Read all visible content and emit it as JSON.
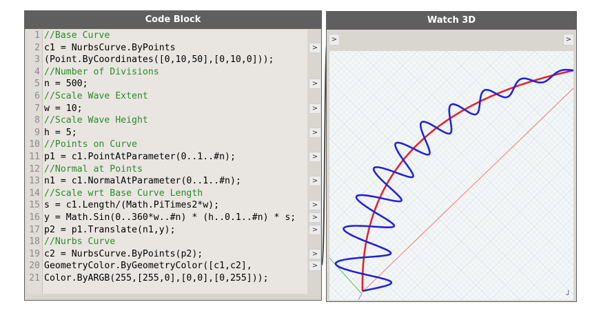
{
  "code_block": {
    "title": "Code Block",
    "lines": [
      {
        "num": "1",
        "text": "//Base Curve",
        "comment": true
      },
      {
        "num": "2",
        "text": "c1 = NurbsCurve.ByPoints",
        "comment": false
      },
      {
        "num": "3",
        "text": "(Point.ByCoordinates([0,10,50],[0,10,0]));",
        "comment": false
      },
      {
        "num": "4",
        "text": "//Number of Divisions",
        "comment": true
      },
      {
        "num": "5",
        "text": "n = 500;",
        "comment": false
      },
      {
        "num": "6",
        "text": "//Scale Wave Extent",
        "comment": true
      },
      {
        "num": "7",
        "text": "w = 10;",
        "comment": false
      },
      {
        "num": "8",
        "text": "//Scale Wave Height",
        "comment": true
      },
      {
        "num": "9",
        "text": "h = 5;",
        "comment": false
      },
      {
        "num": "10",
        "text": "//Points on Curve",
        "comment": true
      },
      {
        "num": "11",
        "text": "p1 = c1.PointAtParameter(0..1..#n);",
        "comment": false
      },
      {
        "num": "12",
        "text": "//Normal at Points",
        "comment": true
      },
      {
        "num": "13",
        "text": "n1 = c1.NormalAtParameter(0..1..#n);",
        "comment": false
      },
      {
        "num": "14",
        "text": "//Scale wrt Base Curve Length",
        "comment": true
      },
      {
        "num": "15",
        "text": "s = c1.Length/(Math.PiTimes2*w);",
        "comment": false
      },
      {
        "num": "16",
        "text": "y = Math.Sin(0..360*w..#n) * (h..0.1..#n) * s;",
        "comment": false
      },
      {
        "num": "17",
        "text": "p2 = p1.Translate(n1,y);",
        "comment": false
      },
      {
        "num": "18",
        "text": "//Nurbs Curve",
        "comment": true
      },
      {
        "num": "19",
        "text": "c2 = NurbsCurve.ByPoints(p2);",
        "comment": false
      },
      {
        "num": "20",
        "text": "GeometryColor.ByGeometryColor([c1,c2],",
        "comment": false
      },
      {
        "num": "21",
        "text": "Color.ByARGB(255,[255,0],[0,0],[0,255]));",
        "comment": false
      }
    ],
    "output_port_glyph": ">",
    "output_port_lines": [
      2,
      5,
      7,
      9,
      11,
      13,
      15,
      16,
      17,
      19,
      20
    ]
  },
  "watch3d": {
    "title": "Watch 3D",
    "input_port_glyph": ">",
    "output_port_glyph": ">",
    "resize_glyph": "┘",
    "colors": {
      "base_curve": "#e4242a",
      "wave_curve": "#2323d8",
      "axis_line": "#f08a8a"
    }
  }
}
